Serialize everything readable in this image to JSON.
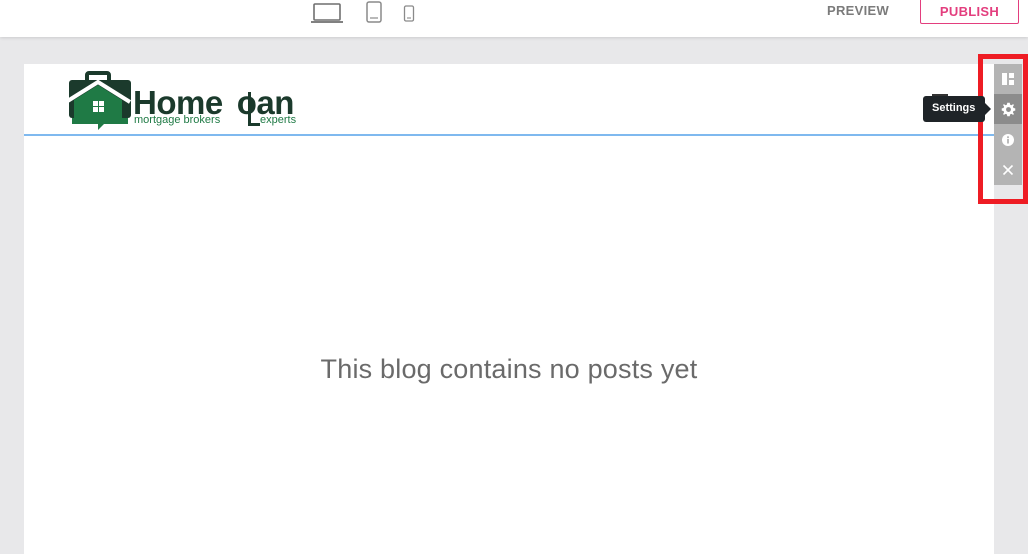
{
  "topbar": {
    "devices": [
      {
        "name": "desktop",
        "icon": "laptop-icon"
      },
      {
        "name": "tablet",
        "icon": "tablet-icon"
      },
      {
        "name": "mobile",
        "icon": "phone-icon"
      }
    ],
    "preview_label": "PREVIEW",
    "publish_label": "PUBLISH"
  },
  "site": {
    "logo": {
      "word": "HomeLoan",
      "tagline_left": "mortgage brokers",
      "tagline_right": "experts",
      "icon": "house-briefcase-logo-icon"
    },
    "empty_message": "This blog contains no posts yet"
  },
  "element_toolbar": {
    "items": [
      {
        "name": "layout",
        "icon": "layout-icon"
      },
      {
        "name": "settings",
        "icon": "gear-icon"
      },
      {
        "name": "info",
        "icon": "info-icon"
      },
      {
        "name": "close",
        "icon": "close-icon"
      }
    ],
    "tooltip": "Settings"
  },
  "colors": {
    "publish_accent": "#e33e7e",
    "header_border": "#7fb9ef",
    "highlight": "#ee1c24",
    "logo_dark": "#1b3a2c",
    "logo_green": "#1f7a45"
  }
}
